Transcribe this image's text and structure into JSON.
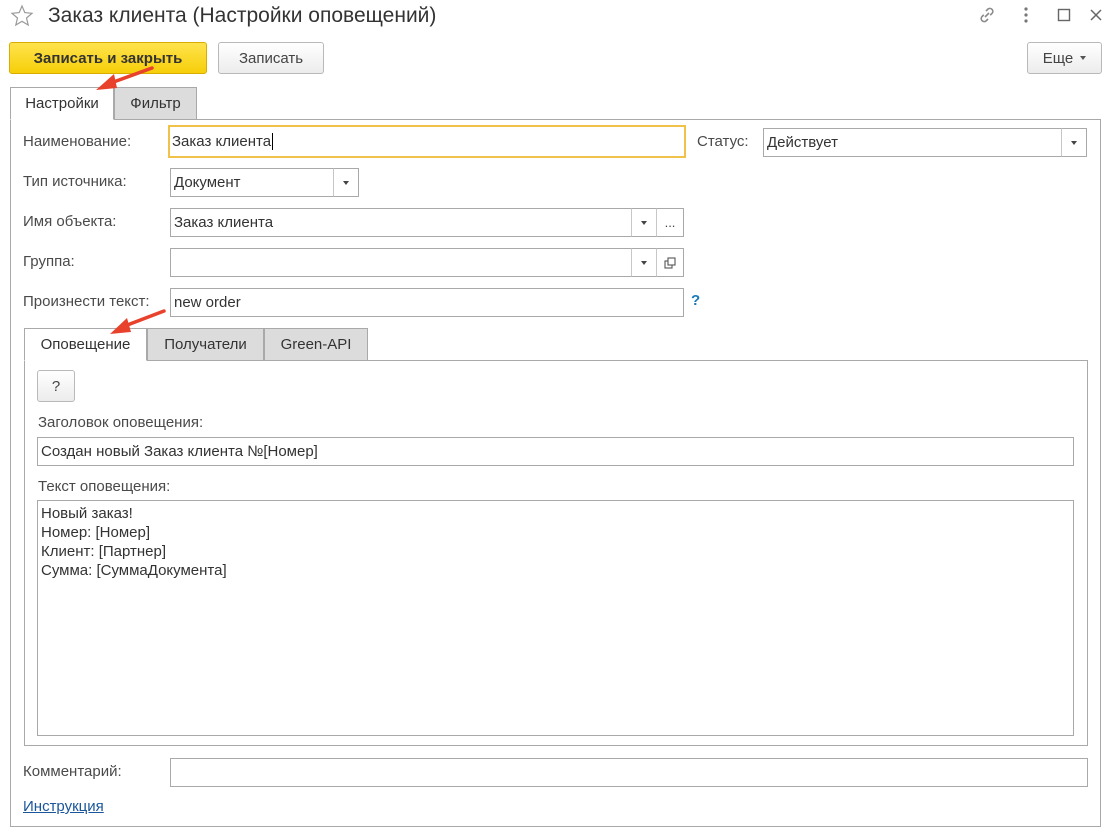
{
  "window": {
    "title": "Заказ клиента (Настройки оповещений)",
    "icons": [
      "star-icon",
      "link-icon",
      "more-vertical-icon",
      "maximize-icon",
      "close-icon"
    ]
  },
  "toolbar": {
    "save_close_label": "Записать и закрыть",
    "save_label": "Записать",
    "more_label": "Еще"
  },
  "tabs": [
    {
      "label": "Настройки",
      "active": true
    },
    {
      "label": "Фильтр",
      "active": false
    }
  ],
  "form": {
    "name_label": "Наименование:",
    "name_value": "Заказ клиента",
    "status_label": "Статус:",
    "status_value": "Действует",
    "source_type_label": "Тип источника:",
    "source_type_value": "Документ",
    "object_name_label": "Имя объекта:",
    "object_name_value": "Заказ клиента",
    "object_browse": "...",
    "group_label": "Группа:",
    "group_value": "",
    "speak_label": "Произнести текст:",
    "speak_value": "new order",
    "speak_help": "?",
    "comment_label": "Комментарий:",
    "comment_value": ""
  },
  "inner_tabs": [
    {
      "label": "Оповещение",
      "active": true
    },
    {
      "label": "Получатели",
      "active": false
    },
    {
      "label": "Green-API",
      "active": false
    }
  ],
  "notification": {
    "help_button": "?",
    "header_label": "Заголовок оповещения:",
    "header_value": "Создан новый Заказ клиента №[Номер]",
    "text_label": "Текст оповещения:",
    "text_value": "Новый заказ!\nНомер: [Номер]\nКлиент: [Партнер]\nСумма: [СуммаДокумента]"
  },
  "footer": {
    "instruction_link": "Инструкция"
  },
  "colors": {
    "primary_button": "#f6cf09",
    "focus_border": "#f0c24a",
    "annotation_arrow": "#e8412c",
    "link": "#1a5699"
  }
}
